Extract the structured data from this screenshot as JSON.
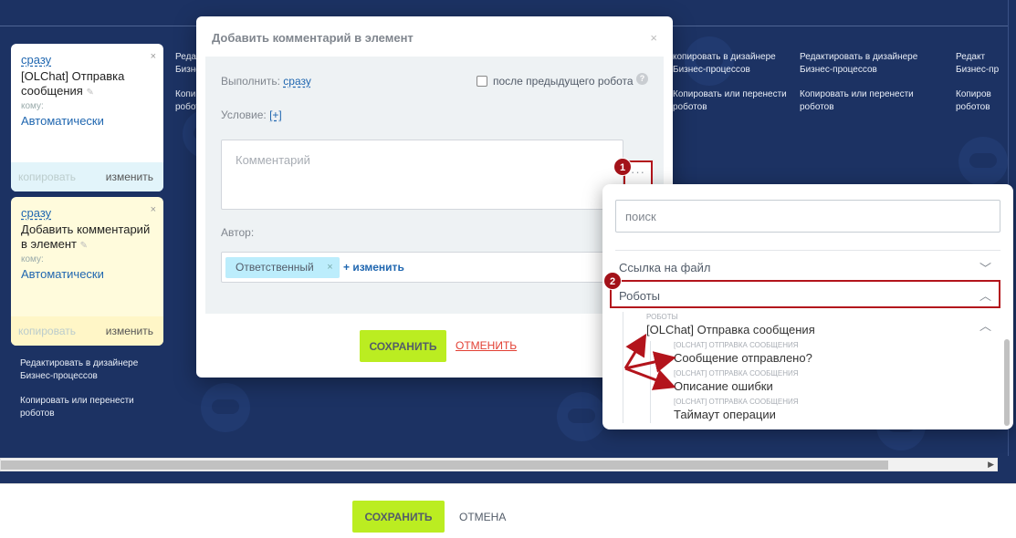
{
  "cards": [
    {
      "when": "сразу",
      "title": "[OLChat] Отправка сообщения",
      "whom": "кому:",
      "recipient": "Автоматически",
      "copy": "копировать",
      "edit": "изменить",
      "close": "×"
    },
    {
      "when": "сразу",
      "title": "Добавить комментарий в элемент",
      "whom": "кому:",
      "recipient": "Автоматически",
      "copy": "копировать",
      "edit": "изменить",
      "close": "×"
    }
  ],
  "bg_links": {
    "designer_1": "Редактировать в дизайнере",
    "designer_2": "Бизнес-процессов",
    "copy_1": "Копировать или перенести",
    "copy_2": "роботов",
    "col2_d1": "Редак",
    "col2_d2": "Бизне",
    "col2_c1": "Копи",
    "col2_c2": "робот",
    "col3_d1": "копировать в дизайнере",
    "col3_d2": "Бизнес-процессов",
    "col3_c1": "Копировать или перенести",
    "col3_c2": "роботов",
    "col5_d1": "Редакт",
    "col5_d2": "Бизнес-пр",
    "col5_c1": "Копиров",
    "col5_c2": "роботов"
  },
  "modal": {
    "title": "Добавить комментарий в элемент",
    "close": "×",
    "execute_label": "Выполнить:",
    "execute_value": "сразу",
    "after_prev_label": "после предыдущего робота",
    "help": "?",
    "condition_label": "Условие:",
    "condition_value": "[+]",
    "comment_placeholder": "Комментарий",
    "dots": "···",
    "author_label": "Автор:",
    "author_tag": "Ответственный",
    "author_tag_remove": "×",
    "author_change": "+ изменить",
    "save": "СОХРАНИТЬ",
    "cancel": "ОТМЕНИТЬ"
  },
  "popup": {
    "search_placeholder": "поиск",
    "sections": [
      {
        "label": "Ссылка на файл",
        "state": "collapsed"
      },
      {
        "label": "Роботы",
        "state": "expanded"
      }
    ],
    "group_caption": "Роботы",
    "group_title": "[OLChat] Отправка сообщения",
    "items": [
      {
        "caption": "[OLChat] Отправка сообщения",
        "label": "Сообщение отправлено?"
      },
      {
        "caption": "[OLChat] Отправка сообщения",
        "label": "Описание ошибки"
      },
      {
        "caption": "[OLChat] Отправка сообщения",
        "label": "Таймаут операции"
      }
    ]
  },
  "markers": [
    "1",
    "2"
  ],
  "bottom": {
    "save": "СОХРАНИТЬ",
    "cancel": "ОТМЕНА"
  },
  "colors": {
    "background": "#1c3263",
    "accent_green": "#bbed21",
    "link_blue": "#2067b0",
    "highlight_red": "#b3141c",
    "cancel_red": "#e24034"
  }
}
